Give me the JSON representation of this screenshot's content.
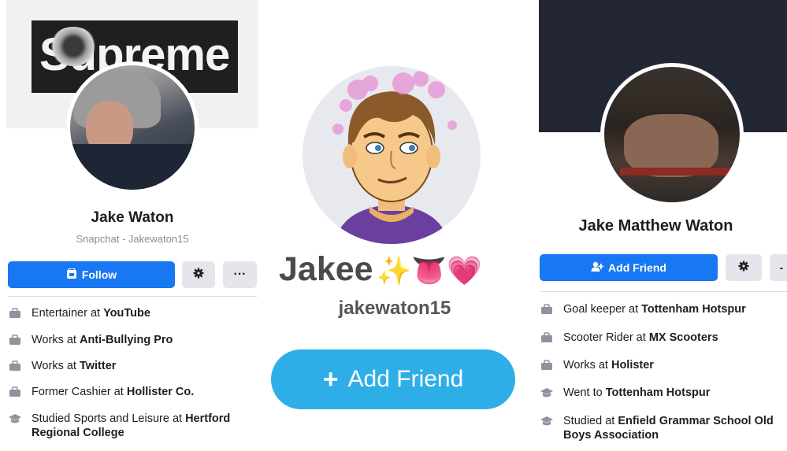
{
  "panel1": {
    "cover_text": "Supreme",
    "name": "Jake Waton",
    "subtitle": "Snapchat - Jakewaton15",
    "follow_label": "Follow",
    "more_label": "···",
    "info": [
      {
        "prefix": "Entertainer at ",
        "bold": "YouTube"
      },
      {
        "prefix": "Works at ",
        "bold": "Anti-Bullying Pro"
      },
      {
        "prefix": "Works at ",
        "bold": "Twitter"
      },
      {
        "prefix": "Former Cashier at ",
        "bold": "Hollister Co."
      },
      {
        "prefix": "Studied Sports and Leisure at ",
        "bold": "Hertford Regional College"
      }
    ]
  },
  "panel2": {
    "display_name": "Jakee",
    "emojis": "✨👅💗",
    "username": "jakewaton15",
    "add_friend_label": "Add Friend",
    "add_symbol": "+"
  },
  "panel3": {
    "name": "Jake Matthew Waton",
    "add_friend_label": "Add Friend",
    "info": [
      {
        "prefix": "Goal keeper at ",
        "bold": "Tottenham Hotspur"
      },
      {
        "prefix": "Scooter Rider at ",
        "bold": "MX Scooters"
      },
      {
        "prefix": "Works at ",
        "bold": "Holister"
      },
      {
        "prefix": "Went to ",
        "bold": "Tottenham Hotspur"
      },
      {
        "prefix": "Studied at ",
        "bold": "Enfield Grammar School Old Boys Association"
      }
    ]
  },
  "colors": {
    "facebook_blue": "#1877f2",
    "snapchat_blue": "#2eaee6",
    "grey_button": "#e4e6eb"
  }
}
